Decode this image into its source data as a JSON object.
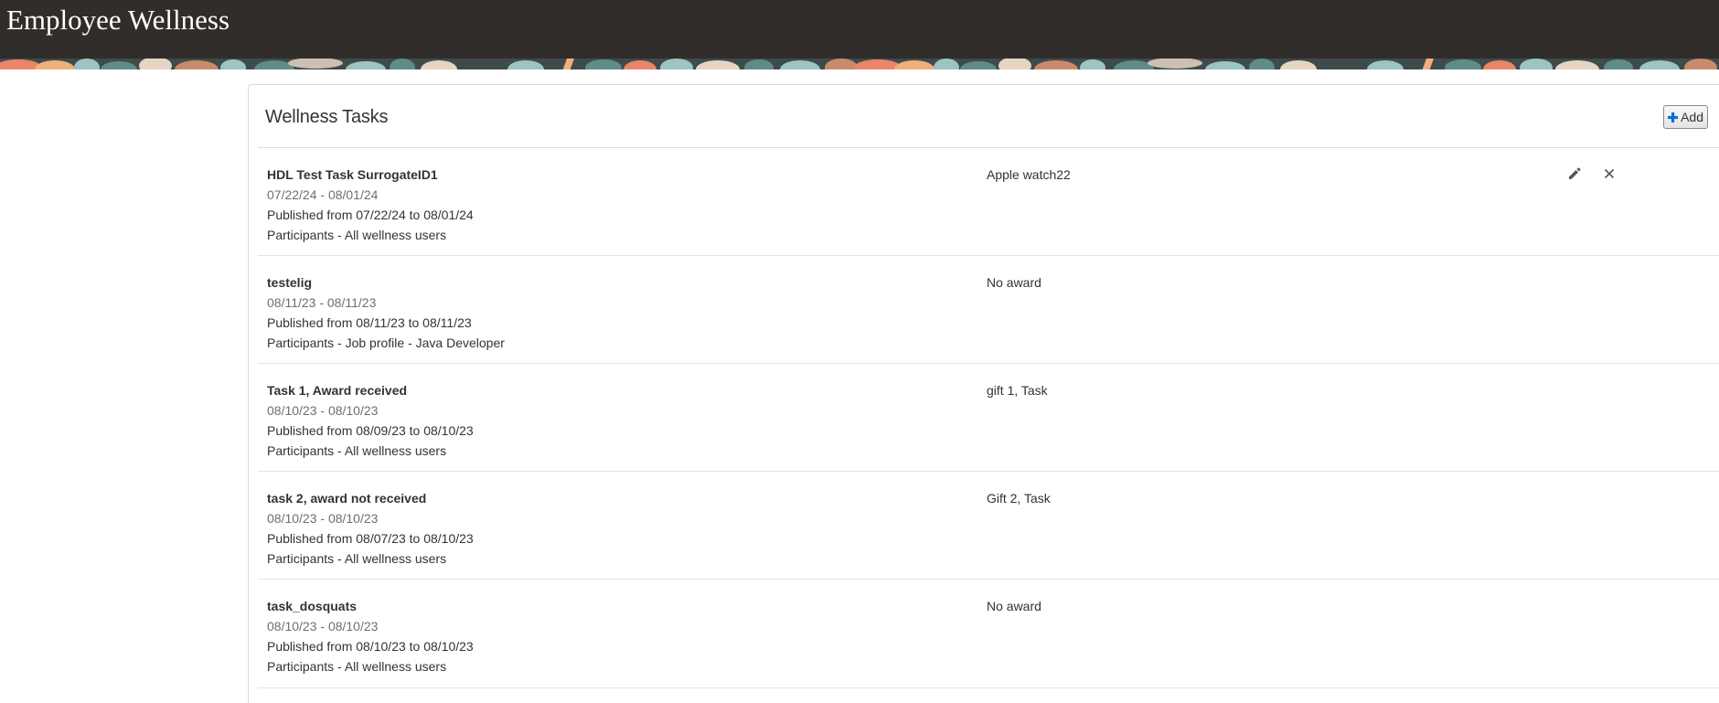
{
  "app": {
    "title": "Employee Wellness"
  },
  "colors": {
    "header_bg": "#312d2a",
    "accent_blue": "#0572ce",
    "banner_palette": [
      "#3d4b4a",
      "#5f8c87",
      "#9cc4c2",
      "#e9856a",
      "#f0b07a",
      "#c98a6b",
      "#e6d5c4"
    ]
  },
  "panel": {
    "title": "Wellness Tasks",
    "add_button": {
      "label": "Add",
      "icon": "plus-icon"
    }
  },
  "row_actions": {
    "edit_icon": "pencil-icon",
    "delete_icon": "close-icon"
  },
  "tasks": [
    {
      "name": "HDL Test Task SurrogateID1",
      "dates": "07/22/24 - 08/01/24",
      "published": "Published from 07/22/24 to 08/01/24",
      "participants": "Participants - All wellness users",
      "award": "Apple watch22"
    },
    {
      "name": "testelig",
      "dates": "08/11/23 - 08/11/23",
      "published": "Published from 08/11/23 to 08/11/23",
      "participants": "Participants - Job profile - Java Developer",
      "award": "No award"
    },
    {
      "name": "Task 1, Award received",
      "dates": "08/10/23 - 08/10/23",
      "published": "Published from 08/09/23 to 08/10/23",
      "participants": "Participants - All wellness users",
      "award": "gift 1, Task"
    },
    {
      "name": "task 2, award not received",
      "dates": "08/10/23 - 08/10/23",
      "published": "Published from 08/07/23 to 08/10/23",
      "participants": "Participants - All wellness users",
      "award": "Gift 2, Task"
    },
    {
      "name": "task_dosquats",
      "dates": "08/10/23 - 08/10/23",
      "published": "Published from 08/10/23 to 08/10/23",
      "participants": "Participants - All wellness users",
      "award": "No award"
    }
  ]
}
